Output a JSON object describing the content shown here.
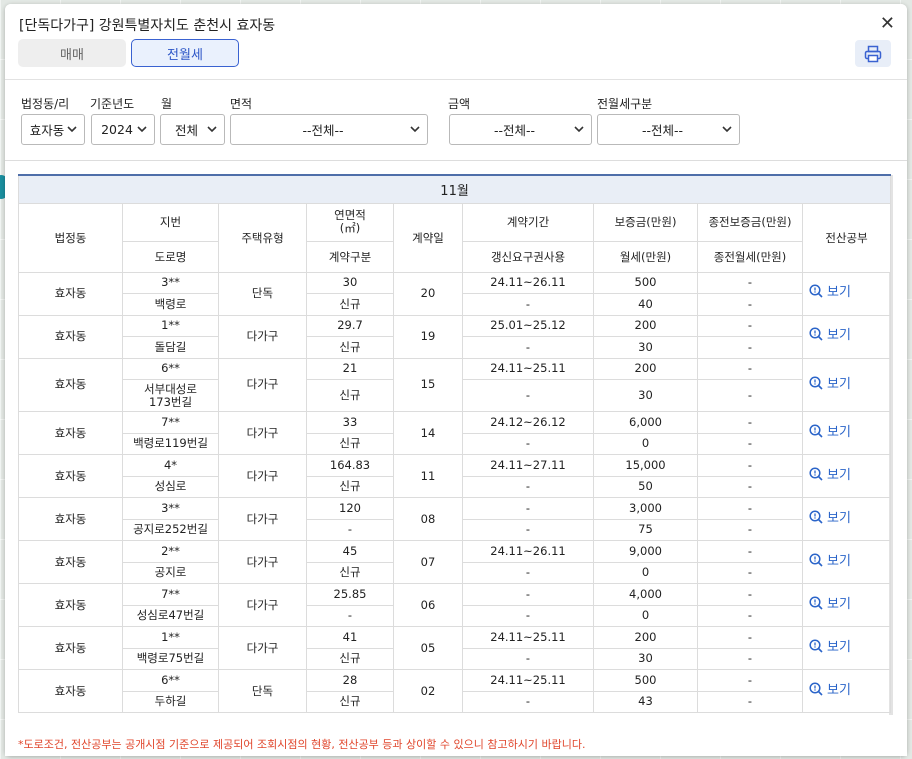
{
  "header": {
    "title": "[단독다가구] 강원특별자치도 춘천시 효자동",
    "close_label": "✕",
    "tabs": [
      {
        "label": "매매",
        "active": false
      },
      {
        "label": "전월세",
        "active": true
      }
    ],
    "print_icon": "printer-icon"
  },
  "filters": {
    "dong": {
      "label": "법정동/리",
      "value": "효자동"
    },
    "year": {
      "label": "기준년도",
      "value": "2024"
    },
    "month": {
      "label": "월",
      "value": "전체"
    },
    "area": {
      "label": "면적",
      "value": "--전체--"
    },
    "amount": {
      "label": "금액",
      "value": "--전체--"
    },
    "rent_type": {
      "label": "전월세구분",
      "value": "--전체--"
    }
  },
  "table": {
    "month_title": "11월",
    "headers": {
      "dong": "법정동",
      "jibun": "지번",
      "road": "도로명",
      "type": "주택유형",
      "area": "연면적\n(㎡)",
      "contract_kind": "계약구분",
      "day": "계약일",
      "period": "계약기간",
      "renewal": "갱신요구권사용",
      "deposit": "보증금(만원)",
      "monthly": "월세(만원)",
      "prev_deposit": "종전보증금(만원)",
      "prev_monthly": "종전월세(만원)",
      "doc": "전산공부"
    },
    "rows": [
      {
        "dong": "효자동",
        "jibun": "3**",
        "road": "백령로",
        "type": "단독",
        "area": "30",
        "kind": "신규",
        "day": "20",
        "period": "24.11~26.11",
        "renewal": "-",
        "deposit": "500",
        "monthly": "40",
        "prev_deposit": "-",
        "prev_monthly": "-",
        "view": "보기"
      },
      {
        "dong": "효자동",
        "jibun": "1**",
        "road": "돌담길",
        "type": "다가구",
        "area": "29.7",
        "kind": "신규",
        "day": "19",
        "period": "25.01~25.12",
        "renewal": "-",
        "deposit": "200",
        "monthly": "30",
        "prev_deposit": "-",
        "prev_monthly": "-",
        "view": "보기"
      },
      {
        "dong": "효자동",
        "jibun": "6**",
        "road": "서부대성로173번길",
        "type": "다가구",
        "area": "21",
        "kind": "신규",
        "day": "15",
        "period": "24.11~25.11",
        "renewal": "-",
        "deposit": "200",
        "monthly": "30",
        "prev_deposit": "-",
        "prev_monthly": "-",
        "view": "보기"
      },
      {
        "dong": "효자동",
        "jibun": "7**",
        "road": "백령로119번길",
        "type": "다가구",
        "area": "33",
        "kind": "신규",
        "day": "14",
        "period": "24.12~26.12",
        "renewal": "-",
        "deposit": "6,000",
        "monthly": "0",
        "prev_deposit": "-",
        "prev_monthly": "-",
        "view": "보기"
      },
      {
        "dong": "효자동",
        "jibun": "4*",
        "road": "성심로",
        "type": "다가구",
        "area": "164.83",
        "kind": "신규",
        "day": "11",
        "period": "24.11~27.11",
        "renewal": "-",
        "deposit": "15,000",
        "monthly": "50",
        "prev_deposit": "-",
        "prev_monthly": "-",
        "view": "보기"
      },
      {
        "dong": "효자동",
        "jibun": "3**",
        "road": "공지로252번길",
        "type": "다가구",
        "area": "120",
        "kind": "-",
        "day": "08",
        "period": "-",
        "renewal": "-",
        "deposit": "3,000",
        "monthly": "75",
        "prev_deposit": "-",
        "prev_monthly": "-",
        "view": "보기"
      },
      {
        "dong": "효자동",
        "jibun": "2**",
        "road": "공지로",
        "type": "다가구",
        "area": "45",
        "kind": "신규",
        "day": "07",
        "period": "24.11~26.11",
        "renewal": "-",
        "deposit": "9,000",
        "monthly": "0",
        "prev_deposit": "-",
        "prev_monthly": "-",
        "view": "보기"
      },
      {
        "dong": "효자동",
        "jibun": "7**",
        "road": "성심로47번길",
        "type": "다가구",
        "area": "25.85",
        "kind": "-",
        "day": "06",
        "period": "-",
        "renewal": "-",
        "deposit": "4,000",
        "monthly": "0",
        "prev_deposit": "-",
        "prev_monthly": "-",
        "view": "보기"
      },
      {
        "dong": "효자동",
        "jibun": "1**",
        "road": "백령로75번길",
        "type": "다가구",
        "area": "41",
        "kind": "신규",
        "day": "05",
        "period": "24.11~25.11",
        "renewal": "-",
        "deposit": "200",
        "monthly": "30",
        "prev_deposit": "-",
        "prev_monthly": "-",
        "view": "보기"
      },
      {
        "dong": "효자동",
        "jibun": "6**",
        "road": "두하길",
        "type": "단독",
        "area": "28",
        "kind": "신규",
        "day": "02",
        "period": "24.11~25.11",
        "renewal": "-",
        "deposit": "500",
        "monthly": "43",
        "prev_deposit": "-",
        "prev_monthly": "-",
        "view": "보기"
      }
    ]
  },
  "footnote": "*도로조건, 전산공부는 공개시점 기준으로 제공되어 조회시점의 현황, 전산공부 등과 상이할 수 있으니 참고하시기 바랍니다."
}
